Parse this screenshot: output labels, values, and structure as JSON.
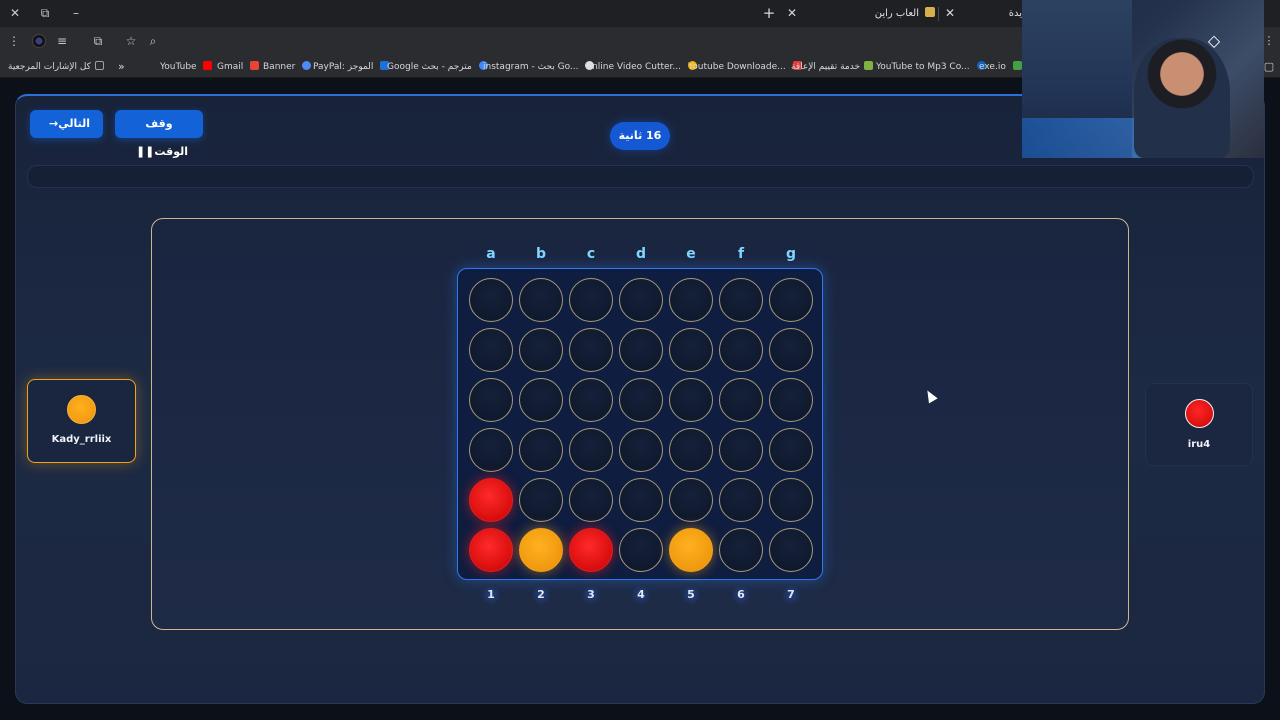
{
  "browser": {
    "window_controls": {
      "close": "✕",
      "maximize": "⧉",
      "minimize": "–"
    },
    "new_tab": "+",
    "tabs": [
      {
        "title": "العاب راين"
      },
      {
        "title": "يدة"
      }
    ],
    "bookmarks": [
      {
        "label": "كل الإشارات المرجعية",
        "color": "#9aa0a6"
      },
      {
        "label": "»",
        "color": ""
      },
      {
        "label": "YouTube",
        "color": "#ff0000"
      },
      {
        "label": "Gmail",
        "color": "#ea4335"
      },
      {
        "label": "Banner",
        "color": "#4c8bf5"
      },
      {
        "label": "PayPal: الموجز",
        "color": "#1f6fd8"
      },
      {
        "label": "Google مترجم - بحث",
        "color": "#4285f4"
      },
      {
        "label": "instagram - بحث Go...",
        "color": "#34a853"
      },
      {
        "label": "Online Video Cutter...",
        "color": "#f4b400"
      },
      {
        "label": "Youtube Downloade...",
        "color": "#e53935"
      },
      {
        "label": "خدمة تقييم الإعاقة",
        "color": "#7cb342"
      },
      {
        "label": "YouTube to Mp3 Co...",
        "color": "#1565c0"
      },
      {
        "label": "exe.io",
        "color": "#43a047"
      }
    ]
  },
  "game": {
    "next_button": "التالي",
    "pause_button": "وقف الوقت",
    "timer": "16 ثانية",
    "progress": 0,
    "column_letters": [
      "a",
      "b",
      "c",
      "d",
      "e",
      "f",
      "g"
    ],
    "column_numbers": [
      "1",
      "2",
      "3",
      "4",
      "5",
      "6",
      "7"
    ],
    "board": [
      [
        ".",
        ".",
        ".",
        ".",
        ".",
        ".",
        "."
      ],
      [
        ".",
        ".",
        ".",
        ".",
        ".",
        ".",
        "."
      ],
      [
        ".",
        ".",
        ".",
        ".",
        ".",
        ".",
        "."
      ],
      [
        ".",
        ".",
        ".",
        ".",
        ".",
        ".",
        "."
      ],
      [
        "R",
        ".",
        ".",
        ".",
        ".",
        ".",
        "."
      ],
      [
        "R",
        "O",
        "R",
        ".",
        "O",
        ".",
        "."
      ]
    ],
    "players": {
      "left": {
        "name": "Kady_rrliix",
        "color": "#f09810",
        "active": true
      },
      "right": {
        "name": "iru4",
        "color": "#d40c0c",
        "active": false
      }
    }
  },
  "colors": {
    "accent": "#1362d8",
    "red_piece": "#e01515",
    "orange_piece": "#f29a10",
    "board_border": "#2f78e6"
  }
}
